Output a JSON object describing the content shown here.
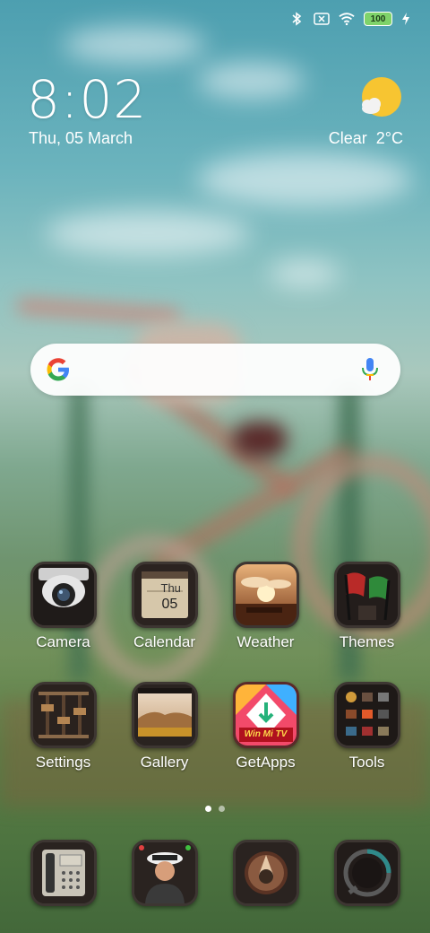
{
  "status_bar": {
    "icons": [
      "bluetooth-icon",
      "no-sim-icon",
      "wifi-icon",
      "battery-icon",
      "charging-icon"
    ],
    "battery_level": "100"
  },
  "clock_widget": {
    "time": "8:02",
    "date": "Thu, 05 March"
  },
  "weather_widget": {
    "icon": "partly-sunny-icon",
    "condition": "Clear",
    "temperature": "2°C"
  },
  "search_bar": {
    "logo": "google-logo",
    "mic_icon": "mic-icon"
  },
  "apps": [
    {
      "label": "Camera",
      "icon": "camera-icon"
    },
    {
      "label": "Calendar",
      "icon": "calendar-icon",
      "day": "Thu",
      "date": "05"
    },
    {
      "label": "Weather",
      "icon": "weather-app-icon"
    },
    {
      "label": "Themes",
      "icon": "themes-icon"
    },
    {
      "label": "Settings",
      "icon": "settings-icon"
    },
    {
      "label": "Gallery",
      "icon": "gallery-icon"
    },
    {
      "label": "GetApps",
      "icon": "getapps-icon",
      "banner": "Win Mi TV"
    },
    {
      "label": "Tools",
      "icon": "tools-folder-icon"
    }
  ],
  "page_indicator": {
    "pages": 2,
    "current": 1
  },
  "dock": [
    {
      "icon": "phone-icon"
    },
    {
      "icon": "contacts-icon"
    },
    {
      "icon": "browser-icon"
    },
    {
      "icon": "messages-icon"
    }
  ],
  "colors": {
    "search_bg": "#ffffff",
    "battery_fill": "#7fd36a",
    "icon_frame": "#2a2522"
  }
}
